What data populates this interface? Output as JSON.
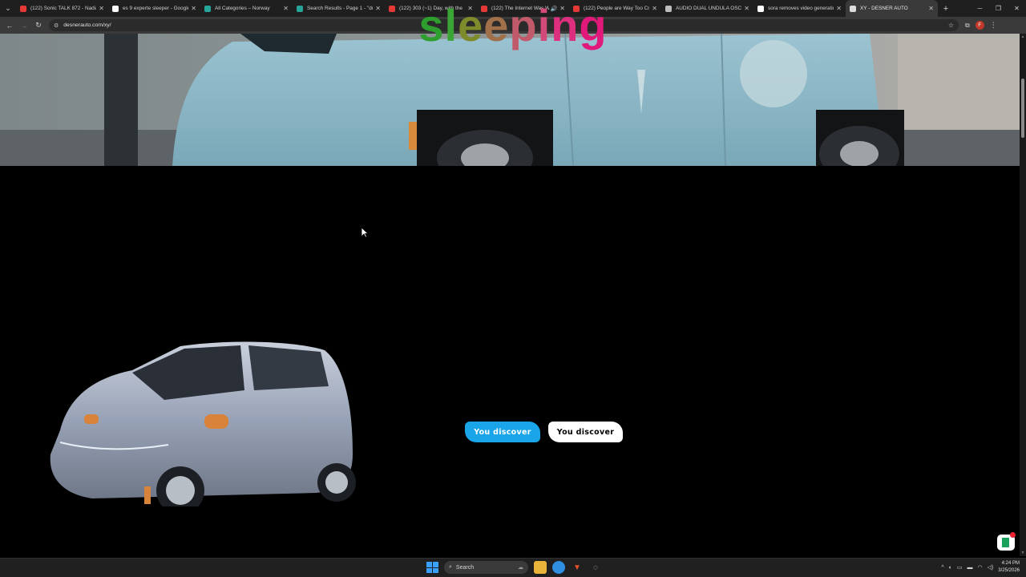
{
  "browser": {
    "tabs": [
      {
        "title": "(122) Sonic TALK 872 - Nadia",
        "favicon_color": "#e53935",
        "active": false
      },
      {
        "title": "es 9 experte sleeper - Google",
        "favicon_color": "#ffffff",
        "active": false
      },
      {
        "title": "All Categories – Norway",
        "favicon_color": "#26a69a",
        "active": false
      },
      {
        "title": "Search Results - Page 1 - \"du",
        "favicon_color": "#26a69a",
        "active": false
      },
      {
        "title": "(122) 303 (~1) Day, with the",
        "favicon_color": "#e53935",
        "active": false
      },
      {
        "title": "(122) The Internet Was W",
        "favicon_color": "#e53935",
        "active": false,
        "audio": true
      },
      {
        "title": "(122) People are Way Too Cra",
        "favicon_color": "#e53935",
        "active": false
      },
      {
        "title": "AUDIO DUAL UNDULA OSCIL",
        "favicon_color": "#bdbdbd",
        "active": false
      },
      {
        "title": "sora removes video generatio",
        "favicon_color": "#ffffff",
        "active": false
      },
      {
        "title": "XY - DESNER AUTO",
        "favicon_color": "#dddddd",
        "active": true
      }
    ],
    "url": "desnerauto.com/xy/",
    "profile_initial": "F"
  },
  "overlay": {
    "letters": [
      {
        "char": "s",
        "color": "#2e9e2e"
      },
      {
        "char": "l",
        "color": "#3aa534"
      },
      {
        "char": "e",
        "color": "#7f8a2a"
      },
      {
        "char": "e",
        "color": "#a0704a"
      },
      {
        "char": "p",
        "color": "#c05a6a"
      },
      {
        "char": "i",
        "color": "#d24a7a"
      },
      {
        "char": "n",
        "color": "#dc2f7d"
      },
      {
        "char": "g",
        "color": "#e0197a"
      }
    ]
  },
  "page": {
    "buttons": {
      "primary_label": "You discover",
      "secondary_label": "You discover"
    },
    "accent_color": "#1aa5e8"
  },
  "taskbar": {
    "search_placeholder": "Search",
    "time": "4:24 PM",
    "date": "3/25/2026"
  }
}
